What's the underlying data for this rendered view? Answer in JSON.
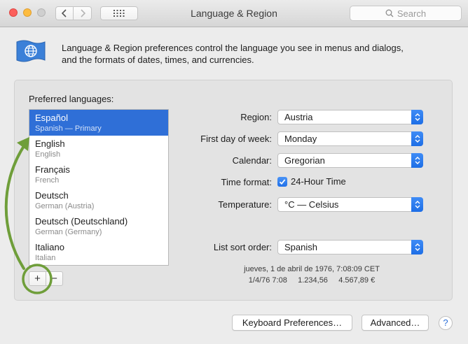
{
  "window": {
    "title": "Language & Region",
    "search_placeholder": "Search"
  },
  "toolbar": {
    "back_icon": "chevron-left-icon",
    "forward_icon": "chevron-right-icon",
    "show_all_icon": "grid-icon"
  },
  "header": {
    "icon": "globe-flag-icon",
    "line1": "Language & Region preferences control the language you see in menus and dialogs,",
    "line2": "and the formats of dates, times, and currencies."
  },
  "languages": {
    "title": "Preferred languages:",
    "items": [
      {
        "name": "Español",
        "sub": "Spanish — Primary",
        "selected": true
      },
      {
        "name": "English",
        "sub": "English",
        "selected": false
      },
      {
        "name": "Français",
        "sub": "French",
        "selected": false
      },
      {
        "name": "Deutsch",
        "sub": "German (Austria)",
        "selected": false
      },
      {
        "name": "Deutsch (Deutschland)",
        "sub": "German (Germany)",
        "selected": false
      },
      {
        "name": "Italiano",
        "sub": "Italian",
        "selected": false
      }
    ],
    "add_label": "+",
    "remove_label": "−"
  },
  "form": {
    "region": {
      "label": "Region:",
      "value": "Austria"
    },
    "first_day": {
      "label": "First day of week:",
      "value": "Monday"
    },
    "calendar": {
      "label": "Calendar:",
      "value": "Gregorian"
    },
    "time_format": {
      "label": "Time format:",
      "checkbox_label": "24-Hour Time",
      "checked": true
    },
    "temperature": {
      "label": "Temperature:",
      "value": "°C — Celsius"
    },
    "sort_order": {
      "label": "List sort order:",
      "value": "Spanish"
    }
  },
  "sample": {
    "line1": "jueves, 1 de abril de 1976, 7:08:09 CET",
    "line2": "1/4/76 7:08     1.234,56     4.567,89 €"
  },
  "buttons": {
    "keyboard": "Keyboard Preferences…",
    "advanced": "Advanced…",
    "help": "?"
  },
  "colors": {
    "selection": "#2f6fd7",
    "annotation": "#6f9e3a"
  }
}
